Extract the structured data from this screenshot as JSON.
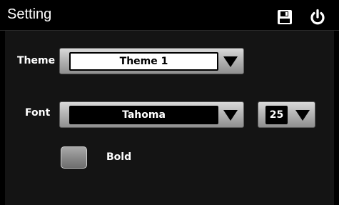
{
  "header": {
    "title": "Setting"
  },
  "icons": {
    "save": "save-icon",
    "power": "power-icon"
  },
  "theme": {
    "label": "Theme",
    "value": "Theme 1"
  },
  "font": {
    "label": "Font",
    "value": "Tahoma",
    "size": "25"
  },
  "bold": {
    "label": "Bold",
    "checked": false
  },
  "colors": {
    "background": "#000000",
    "panel": "#141414",
    "text": "#ffffff",
    "control_light": "#d9d9d9",
    "control_dark": "#8f8f8f"
  }
}
